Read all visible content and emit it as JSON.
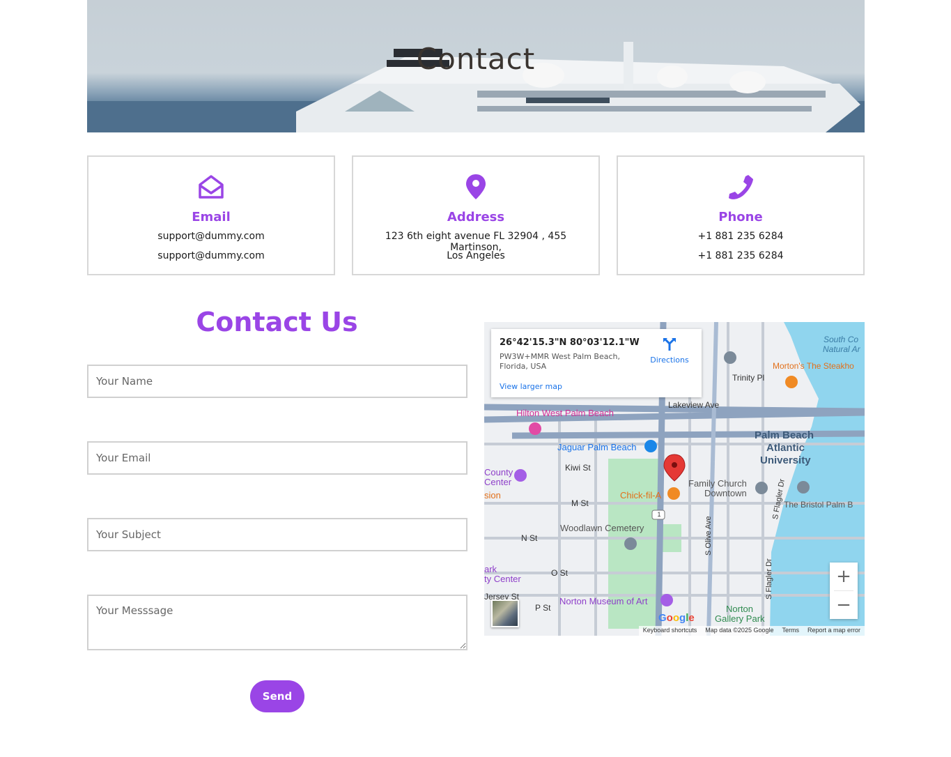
{
  "hero": {
    "title": "Contact"
  },
  "cards": [
    {
      "title": "Email",
      "line1": "support@dummy.com",
      "line2": "support@dummy.com",
      "icon": "envelope-open-icon"
    },
    {
      "title": "Address",
      "line1": "123 6th eight avenue FL 32904 , 455 Martinson,",
      "line2": "Los Angeles",
      "icon": "map-pin-icon"
    },
    {
      "title": "Phone",
      "line1": "+1 881 235 6284",
      "line2": "+1 881 235 6284",
      "icon": "phone-icon"
    }
  ],
  "form": {
    "title": "Contact Us",
    "name_placeholder": "Your Name",
    "email_placeholder": "Your Email",
    "subject_placeholder": "Your Subject",
    "message_placeholder": "Your Messsage",
    "send_label": "Send"
  },
  "map": {
    "coord": "26°42'15.3\"N 80°03'12.1\"W",
    "address": "PW3W+MMR West Palm Beach, Florida, USA",
    "directions": "Directions",
    "larger": "View larger map",
    "zoom_in": "+",
    "zoom_out": "−",
    "attribution": [
      "Keyboard shortcuts",
      "Map data ©2025 Google",
      "Terms",
      "Report a map error"
    ],
    "labels": {
      "hilton": "Hilton West Palm Beach",
      "jaguar": "Jaguar Palm Beach",
      "lakeview": "Lakeview Ave",
      "trinity": "Trinity Pl",
      "mortons": "Morton's The Steakho",
      "south": "South Co",
      "natural": "Natural Ar",
      "pb1": "Palm Beach",
      "pb2": "Atlantic",
      "pb3": "University",
      "kiwi": "Kiwi St",
      "family1": "Family Church",
      "family2": "Downtown",
      "chick": "Chick-fil-A",
      "bristol": "The Bristol Palm B",
      "mst": "M St",
      "woodlawn": "Woodlawn Cemetery",
      "nst": "N St",
      "ost": "O St",
      "pst": "P St",
      "norton": "Norton Museum of Art",
      "ngp1": "Norton",
      "ngp2": "Gallery Park",
      "olive": "S Olive Ave",
      "flagler": "S Flagler Dr",
      "flagler2": "S Flagler Dr",
      "county1": "County",
      "county2": "Center",
      "sion": "sion",
      "ark": "ark",
      "tycenter": "ty Center",
      "jersey": "Jersey St",
      "route": "1",
      "google": "Google"
    }
  },
  "colors": {
    "accent": "#9a45e6",
    "water": "#90d5ee",
    "park": "#b9e6c3",
    "road": "#8ea3bf"
  }
}
